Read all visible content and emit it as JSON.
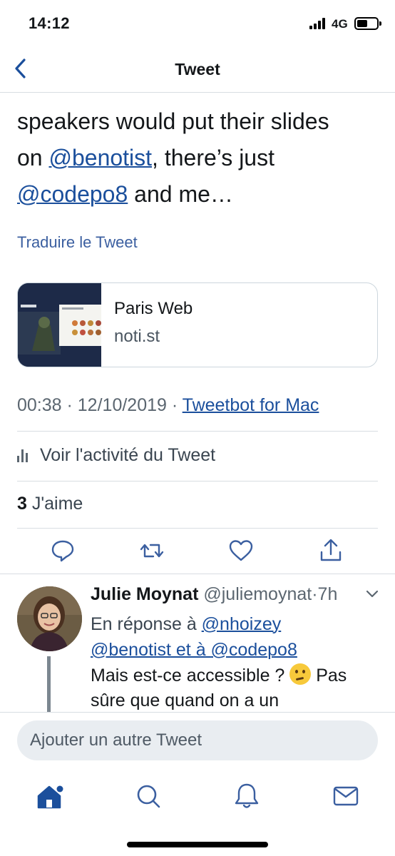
{
  "status_bar": {
    "time": "14:12",
    "network": "4G"
  },
  "header": {
    "title": "Tweet"
  },
  "tweet": {
    "line1": "speakers would put their slides",
    "line2_prefix": "on ",
    "mention1": "@benotist",
    "line2_suffix": ", there’s just",
    "mention2": "@codepo8",
    "line3_suffix": " and me…",
    "translate_label": "Traduire le Tweet"
  },
  "card": {
    "title": "Paris Web",
    "domain": "noti.st"
  },
  "meta": {
    "time": "00:38",
    "date": "12/10/2019",
    "separator": " · ",
    "via": "Tweetbot for Mac"
  },
  "activity_label": "Voir l'activité du Tweet",
  "likes": {
    "count": "3",
    "label": " J'aime"
  },
  "reply": {
    "name": "Julie Moynat",
    "handle": "@juliemoynat",
    "age": "7h",
    "in_reply_to_prefix": "En réponse à ",
    "reply_mention1": "@nhoizey",
    "reply_mention2": "@benotist",
    "reply_and": " et à ",
    "reply_mention3": "@codepo8",
    "body_part1": "Mais est-ce accessible ? ",
    "body_part2": " Pas sûre que quand on a un",
    "emoji_name": "thinking-face"
  },
  "compose": {
    "placeholder": "Ajouter un autre Tweet"
  },
  "tabs": [
    "home-icon",
    "search-icon",
    "bell-icon",
    "mail-icon"
  ],
  "colors": {
    "accent": "#1b4f9c",
    "text": "#14171a",
    "muted": "#5b6670",
    "compose_bg": "#e9edf1"
  }
}
